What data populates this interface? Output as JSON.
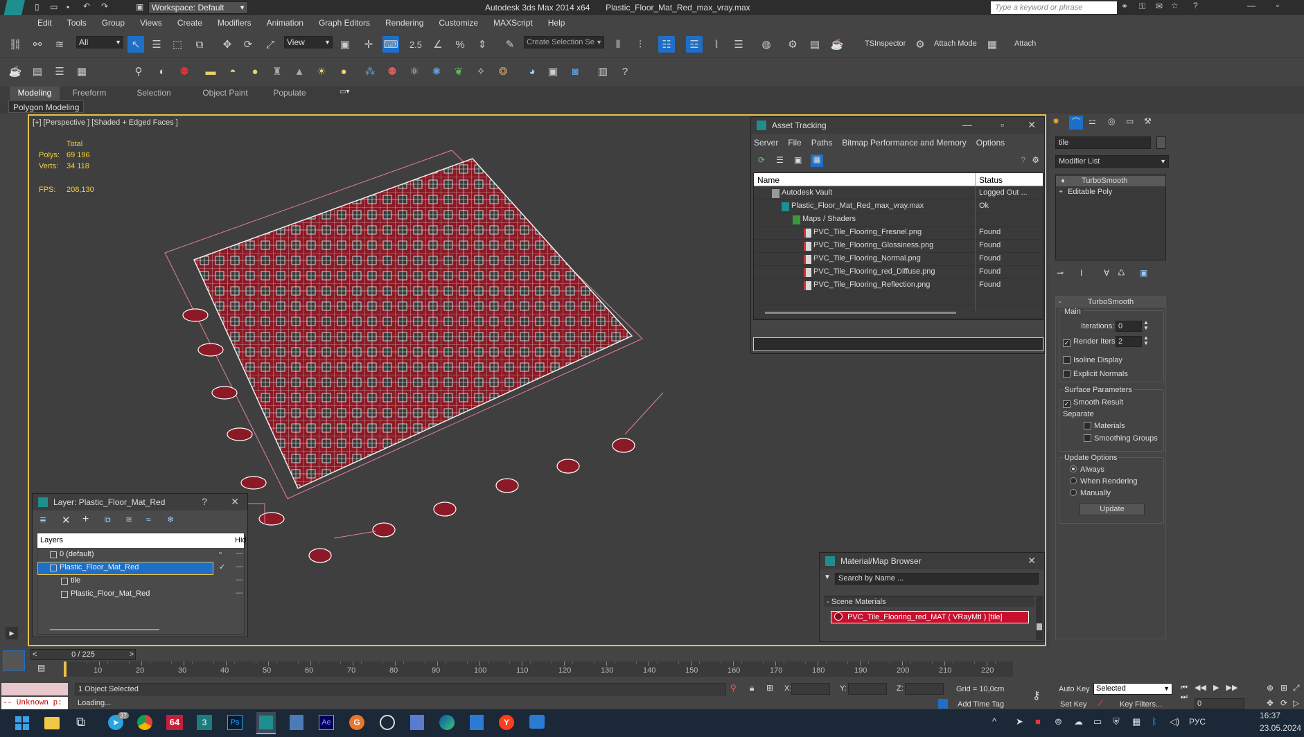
{
  "app": {
    "workspace": "Workspace: Default",
    "title_app": "Autodesk 3ds Max  2014 x64",
    "title_file": "Plastic_Floor_Mat_Red_max_vray.max",
    "search_placeholder": "Type a keyword or phrase"
  },
  "menu": [
    "Edit",
    "Tools",
    "Group",
    "Views",
    "Create",
    "Modifiers",
    "Animation",
    "Graph Editors",
    "Rendering",
    "Customize",
    "MAXScript",
    "Help"
  ],
  "toolbar": {
    "filter": "All",
    "ref_coord": "View",
    "snap_label": "2.5",
    "selection_set_placeholder": "Create Selection Se",
    "tsinspector": "TSInspector",
    "attach_mode": "Attach Mode",
    "attach": "Attach"
  },
  "ribbon": {
    "tabs": [
      "Modeling",
      "Freeform",
      "Selection",
      "Object Paint",
      "Populate"
    ],
    "active_tab": "Modeling",
    "sub": "Polygon Modeling"
  },
  "viewport": {
    "label": "[+] [Perspective ] [Shaded + Edged Faces ]",
    "stats_header": "Total",
    "polys_label": "Polys:",
    "polys_value": "69 196",
    "verts_label": "Verts:",
    "verts_value": "34 118",
    "fps_label": "FPS:",
    "fps_value": "208,130"
  },
  "asset_tracking": {
    "title": "Asset Tracking",
    "menu": [
      "Server",
      "File",
      "Paths",
      "Bitmap Performance and Memory",
      "Options"
    ],
    "col_name": "Name",
    "col_status": "Status",
    "rows": [
      {
        "name": "Autodesk Vault",
        "status": "Logged Out ..."
      },
      {
        "name": "Plastic_Floor_Mat_Red_max_vray.max",
        "status": "Ok"
      },
      {
        "name": "Maps / Shaders",
        "status": ""
      },
      {
        "name": "PVC_Tile_Flooring_Fresnel.png",
        "status": "Found"
      },
      {
        "name": "PVC_Tile_Flooring_Glossiness.png",
        "status": "Found"
      },
      {
        "name": "PVC_Tile_Flooring_Normal.png",
        "status": "Found"
      },
      {
        "name": "PVC_Tile_Flooring_red_Diffuse.png",
        "status": "Found"
      },
      {
        "name": "PVC_Tile_Flooring_Reflection.png",
        "status": "Found"
      }
    ]
  },
  "layer_dialog": {
    "title": "Layer: Plastic_Floor_Mat_Red",
    "col_layers": "Layers",
    "col_hide": "Hid",
    "rows": [
      "0 (default)",
      "Plastic_Floor_Mat_Red",
      "tile",
      "Plastic_Floor_Mat_Red"
    ]
  },
  "material_browser": {
    "title": "Material/Map Browser",
    "search_placeholder": "Search by Name ...",
    "section": "Scene Materials",
    "item": "PVC_Tile_Flooring_red_MAT  ( VRayMtl )  [tile]"
  },
  "command_panel": {
    "object_name": "tile",
    "modifier_list": "Modifier List",
    "stack": [
      "TurboSmooth",
      "Editable Poly"
    ],
    "rollout_title": "TurboSmooth",
    "main_label": "Main",
    "iterations_label": "Iterations:",
    "iterations_value": "0",
    "render_iters_label": "Render Iters:",
    "render_iters_value": "2",
    "isoline": "Isoline Display",
    "explicit_normals": "Explicit Normals",
    "surface_params": "Surface Parameters",
    "smooth_result": "Smooth Result",
    "separate": "Separate",
    "materials": "Materials",
    "smoothing_groups": "Smoothing Groups",
    "update_options": "Update Options",
    "always": "Always",
    "when_rendering": "When Rendering",
    "manually": "Manually",
    "update_button": "Update"
  },
  "timeline": {
    "frame_display": "0 / 225",
    "ticks": [
      "10",
      "20",
      "30",
      "40",
      "50",
      "60",
      "70",
      "80",
      "90",
      "100",
      "110",
      "120",
      "130",
      "140",
      "150",
      "160",
      "170",
      "180",
      "190",
      "200",
      "210",
      "220"
    ]
  },
  "status": {
    "maxscript": "-- Unknown p:",
    "selected": "1 Object Selected",
    "loading": "Loading...",
    "x_label": "X:",
    "y_label": "Y:",
    "z_label": "Z:",
    "grid": "Grid = 10,0cm",
    "add_time_tag": "Add Time Tag",
    "auto_key": "Auto Key",
    "selected_dropdown": "Selected",
    "set_key": "Set Key",
    "key_filters": "Key Filters...",
    "frame_value": "0"
  },
  "taskbar": {
    "lang": "РУС",
    "time": "16:37",
    "date": "23.05.2024",
    "badge": "37",
    "num_badge": "64"
  },
  "colors": {
    "accent_blue": "#1e6fc8",
    "mesh_red": "#8b1a26",
    "viewport_bg": "#3f3f3f",
    "material_swatch": "#c8102e"
  }
}
